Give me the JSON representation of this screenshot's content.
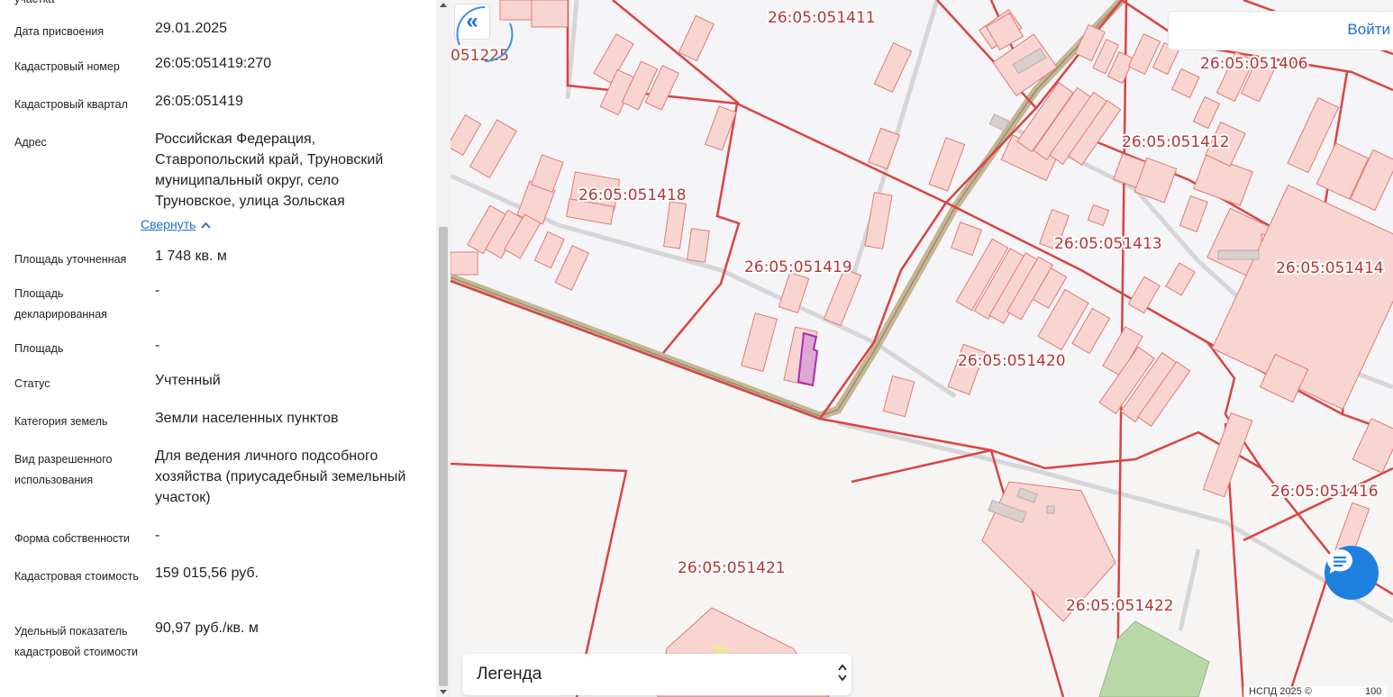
{
  "panel": {
    "top_cut_label": "участка",
    "fields": [
      {
        "label": "Дата присвоения",
        "value": "29.01.2025"
      },
      {
        "label": "Кадастровый номер",
        "value": "26:05:051419:270"
      },
      {
        "label": "Кадастровый квартал",
        "value": "26:05:051419"
      },
      {
        "label": "Адрес",
        "value": "Российская Федерация, Ставропольский край, Труновский муниципальный округ, село Труновское, улица Зольская"
      },
      {
        "label": "Площадь уточненная",
        "value": "1 748 кв. м"
      },
      {
        "label": "Площадь декларированная",
        "value": "-"
      },
      {
        "label": "Площадь",
        "value": "-"
      },
      {
        "label": "Статус",
        "value": "Учтенный"
      },
      {
        "label": "Категория земель",
        "value": "Земли населенных пунктов"
      },
      {
        "label": "Вид разрешенного использования",
        "value": "Для ведения личного подсобного хозяйства (приусадебный земельный участок)"
      },
      {
        "label": "Форма собственности",
        "value": "-"
      },
      {
        "label": "Кадастровая стоимость",
        "value": "159 015,56 руб."
      },
      {
        "label": "Удельный показатель кадастровой стоимости",
        "value": "90,97 руб./кв. м"
      }
    ],
    "collapse_link": "Свернуть"
  },
  "map": {
    "login_label": "Войти",
    "legend_title": "Легенда",
    "copyright": "НСПД 2025 ©",
    "scale_text": "100",
    "quarter_labels": [
      "26:05:051411",
      "051225",
      "26:05:051406",
      "26:05:051412",
      "26:05:051418",
      "26:05:051413",
      "26:05:051419",
      "26:05:051414",
      "26:05:051420",
      "26:05:051416",
      "26:05:051421",
      "26:05:051422"
    ],
    "colors": {
      "boundary": "#d94444",
      "parcel_fill": "#f9d5d2",
      "selected": "#b02aa6",
      "road": "#c9bca0",
      "accent": "#1f80e0"
    }
  }
}
